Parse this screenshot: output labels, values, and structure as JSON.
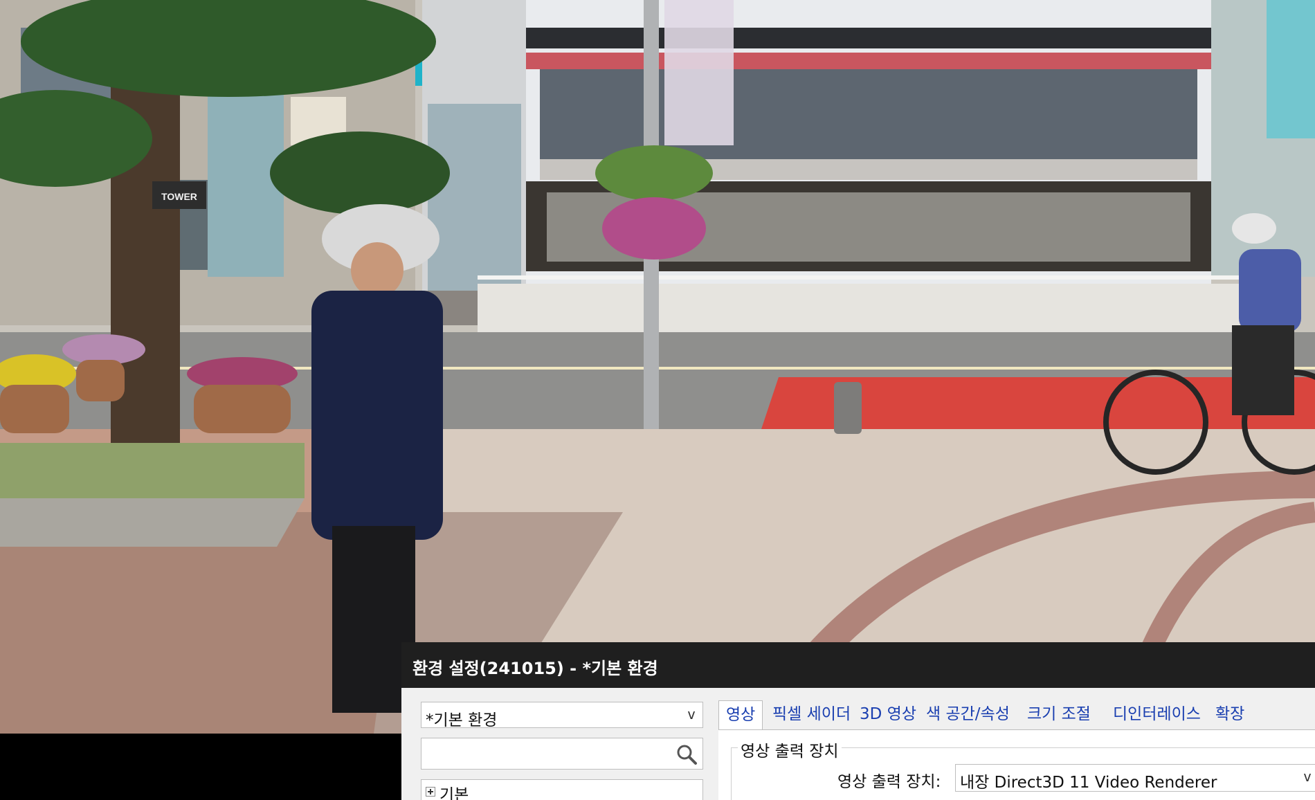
{
  "photo": {
    "description_icon": "street-photo",
    "signs": {
      "tower": "TOWER"
    }
  },
  "dialog": {
    "title": "환경 설정(241015) - *기본 환경",
    "profile_select": {
      "value": "*기본 환경",
      "chevron": "v"
    },
    "search": {
      "placeholder": "",
      "icon": "search-icon"
    },
    "tree": {
      "items": [
        {
          "label": "기본",
          "expander": "+"
        }
      ]
    },
    "tabs": [
      {
        "label": "영상"
      },
      {
        "label": "픽셀 세이더"
      },
      {
        "label": "3D 영상"
      },
      {
        "label": "색 공간/속성"
      },
      {
        "label": "크기 조절"
      },
      {
        "label": "디인터레이스"
      },
      {
        "label": "확장"
      }
    ],
    "group": {
      "title": "영상 출력 장치",
      "renderer_label": "영상 출력 장치:",
      "renderer_value": "내장 Direct3D 11 Video Renderer",
      "chevron": "v"
    }
  },
  "colors": {
    "titlebar": "#1f1f1f",
    "dialog_bg": "#f0f0f0",
    "tab_text": "#1a3fb0",
    "bike_lane": "#d9453e"
  }
}
